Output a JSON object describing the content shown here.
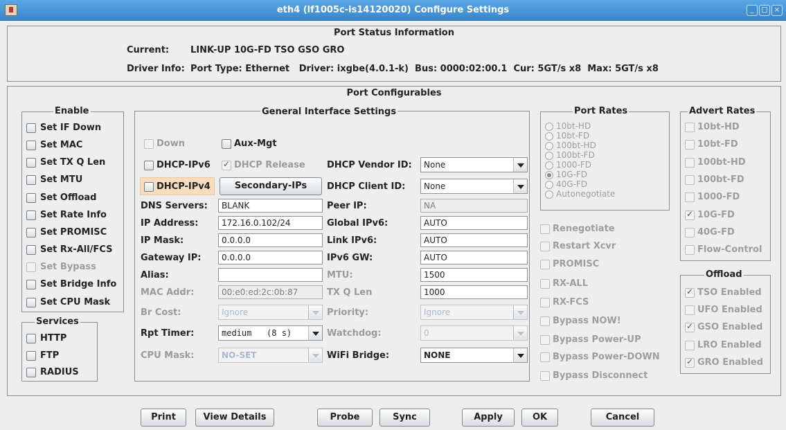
{
  "window": {
    "title": "eth4 (lf1005c-is14120020) Configure Settings",
    "controls": [
      "_",
      "□",
      "×"
    ]
  },
  "status": {
    "title": "Port Status Information",
    "current_label": "Current:",
    "current_value": "LINK-UP 10G-FD TSO GSO GRO",
    "driver_label": "Driver Info:",
    "driver_value": "Port Type: Ethernet   Driver: ixgbe(4.0.1-k)  Bus: 0000:02:00.1  Cur: 5GT/s x8  Max: 5GT/s x8"
  },
  "config": {
    "title": "Port Configurables"
  },
  "enable": {
    "title": "Enable",
    "items": [
      "Set IF Down",
      "Set MAC",
      "Set TX Q Len",
      "Set MTU",
      "Set Offload",
      "Set Rate Info",
      "Set PROMISC",
      "Set Rx-All/FCS",
      "Set Bypass",
      "Set Bridge Info",
      "Set CPU Mask"
    ]
  },
  "services": {
    "title": "Services",
    "items": [
      "HTTP",
      "FTP",
      "RADIUS"
    ]
  },
  "general": {
    "title": "General Interface Settings",
    "down": "Down",
    "aux": "Aux-Mgt",
    "dhcp6": "DHCP-IPv6",
    "dhcp_release": "DHCP Release",
    "dhcp4": "DHCP-IPv4",
    "secondary_button": "Secondary-IPs",
    "vendor_label": "DHCP Vendor ID:",
    "vendor_value": "None",
    "client_label": "DHCP Client ID:",
    "client_value": "None",
    "dns_label": "DNS Servers:",
    "dns_value": "BLANK",
    "peer_label": "Peer IP:",
    "peer_value": "NA",
    "ip_label": "IP Address:",
    "ip_value": "172.16.0.102/24",
    "gipv6_label": "Global IPv6:",
    "gipv6_value": "AUTO",
    "mask_label": "IP Mask:",
    "mask_value": "0.0.0.0",
    "lipv6_label": "Link IPv6:",
    "lipv6_value": "AUTO",
    "gw_label": "Gateway IP:",
    "gw_value": "0.0.0.0",
    "gw6_label": "IPv6 GW:",
    "gw6_value": "AUTO",
    "alias_label": "Alias:",
    "alias_value": "",
    "mtu_label": "MTU:",
    "mtu_value": "1500",
    "mac_label": "MAC Addr:",
    "mac_value": "00:e0:ed:2c:0b:87",
    "txq_label": "TX Q Len",
    "txq_value": "1000",
    "brcost_label": "Br Cost:",
    "brcost_value": "Ignore",
    "prio_label": "Priority:",
    "prio_value": "Ignore",
    "rpt_label": "Rpt Timer:",
    "rpt_value": "medium   (8 s)",
    "watchdog_label": "Watchdog:",
    "watchdog_value": "0",
    "cpumask_label": "CPU Mask:",
    "cpumask_value": "NO-SET",
    "wifi_label": "WiFi Bridge:",
    "wifi_value": "NONE"
  },
  "rates": {
    "title": "Port Rates",
    "items": [
      "10bt-HD",
      "10bt-FD",
      "100bt-HD",
      "100bt-FD",
      "1000-FD",
      "10G-FD",
      "40G-FD",
      "Autonegotiate"
    ],
    "selected": "10G-FD"
  },
  "port_opts": [
    "Renegotiate",
    "Restart Xcvr",
    "PROMISC",
    "RX-ALL",
    "RX-FCS",
    "Bypass NOW!",
    "Bypass Power-UP",
    "Bypass Power-DOWN",
    "Bypass Disconnect"
  ],
  "advert": {
    "title": "Advert Rates",
    "items": [
      "10bt-HD",
      "10bt-FD",
      "100bt-HD",
      "100bt-FD",
      "1000-FD",
      "10G-FD",
      "40G-FD",
      "Flow-Control"
    ],
    "checked": [
      "10G-FD"
    ]
  },
  "offload": {
    "title": "Offload",
    "items": [
      "TSO Enabled",
      "UFO Enabled",
      "GSO Enabled",
      "LRO Enabled",
      "GRO Enabled"
    ],
    "checked": [
      "TSO Enabled",
      "GSO Enabled",
      "GRO Enabled"
    ]
  },
  "buttons": {
    "print": "Print",
    "view_details": "View Details",
    "probe": "Probe",
    "sync": "Sync",
    "apply": "Apply",
    "ok": "OK",
    "cancel": "Cancel"
  }
}
